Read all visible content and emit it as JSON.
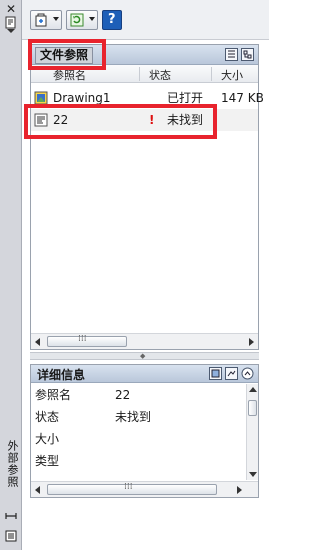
{
  "sidebar": {
    "title": "外部参照",
    "close_glyph": "✕"
  },
  "toolbar": {
    "buttons": [
      {
        "icon": "attach-drawing-icon"
      },
      {
        "icon": "refresh-icon"
      },
      {
        "icon": "help-icon",
        "label": "?"
      }
    ]
  },
  "file_refs": {
    "title": "文件参照",
    "columns": [
      "参照名",
      "状态",
      "大小"
    ],
    "rows": [
      {
        "name": "Drawing1",
        "status": "已打开",
        "size": "147 KB",
        "warning": ""
      },
      {
        "name": "22",
        "status": "未找到",
        "size": "",
        "warning": "!"
      }
    ]
  },
  "details": {
    "title": "详细信息",
    "fields": [
      {
        "key": "参照名",
        "value": "22"
      },
      {
        "key": "状态",
        "value": "未找到"
      },
      {
        "key": "大小",
        "value": ""
      },
      {
        "key": "类型",
        "value": ""
      }
    ]
  },
  "colors": {
    "highlight": "#e8232d",
    "header_blue": "#b9c7da",
    "selection": "#f2f2f2"
  }
}
